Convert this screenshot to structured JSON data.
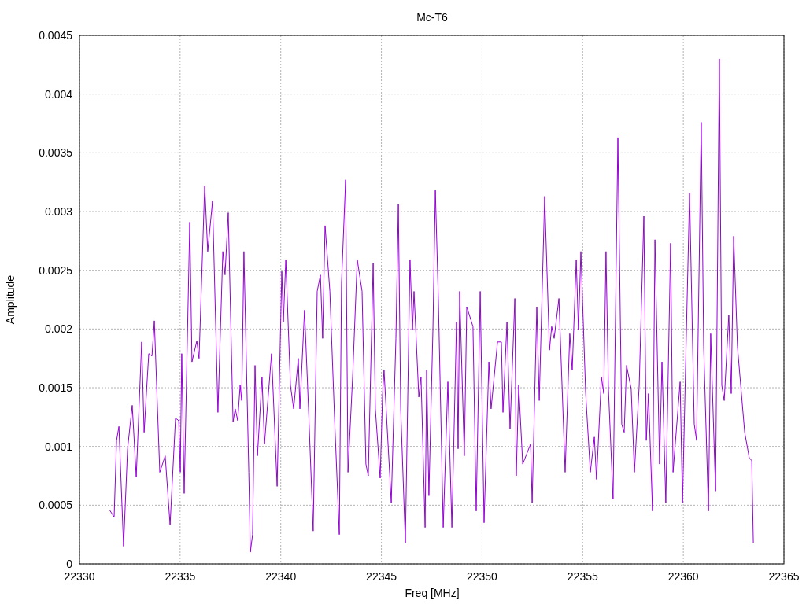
{
  "chart": {
    "chart_data": {
      "type": "line",
      "grid": true,
      "title": "Mc-T6",
      "xlabel": "Freq [MHz]",
      "ylabel": "Amplitude",
      "xlim": [
        22330,
        22365
      ],
      "ylim": [
        0,
        0.0045
      ],
      "xticks": [
        22330,
        22335,
        22340,
        22345,
        22350,
        22355,
        22360,
        22365
      ],
      "yticks": [
        0,
        0.0005,
        0.001,
        0.0015,
        0.002,
        0.0025,
        0.003,
        0.0035,
        0.004,
        0.0045
      ],
      "x": [
        22331.49,
        22331.72,
        22331.84,
        22331.96,
        22332.19,
        22332.39,
        22332.62,
        22332.82,
        22333.09,
        22333.21,
        22333.44,
        22333.6,
        22333.72,
        22333.99,
        22334.26,
        22334.5,
        22334.77,
        22334.93,
        22335.01,
        22335.08,
        22335.2,
        22335.48,
        22335.59,
        22335.83,
        22335.94,
        22336.22,
        22336.37,
        22336.61,
        22336.88,
        22337.12,
        22337.23,
        22337.39,
        22337.63,
        22337.74,
        22337.86,
        22337.98,
        22338.06,
        22338.17,
        22338.41,
        22338.49,
        22338.6,
        22338.72,
        22338.84,
        22339.07,
        22339.19,
        22339.54,
        22339.82,
        22340.05,
        22340.13,
        22340.25,
        22340.48,
        22340.64,
        22340.87,
        22340.95,
        22341.18,
        22341.38,
        22341.61,
        22341.81,
        22341.97,
        22342.08,
        22342.2,
        22342.44,
        22342.67,
        22342.91,
        22343.02,
        22343.22,
        22343.34,
        22343.57,
        22343.8,
        22344.04,
        22344.23,
        22344.35,
        22344.59,
        22344.7,
        22344.94,
        22345.06,
        22345.13,
        22345.49,
        22345.72,
        22345.84,
        22345.96,
        22346.19,
        22346.42,
        22346.54,
        22346.62,
        22346.86,
        22346.97,
        22347.17,
        22347.25,
        22347.36,
        22347.56,
        22347.68,
        22347.83,
        22348.07,
        22348.3,
        22348.5,
        22348.73,
        22348.81,
        22348.89,
        22349.12,
        22349.24,
        22349.55,
        22349.71,
        22349.91,
        22350.1,
        22350.34,
        22350.45,
        22350.77,
        22350.96,
        22351.04,
        22351.24,
        22351.39,
        22351.63,
        22351.7,
        22351.82,
        22352.02,
        22352.41,
        22352.49,
        22352.72,
        22352.84,
        22353.11,
        22353.35,
        22353.46,
        22353.58,
        22353.82,
        22354.13,
        22354.36,
        22354.48,
        22354.68,
        22354.79,
        22354.91,
        22355.15,
        22355.38,
        22355.58,
        22355.69,
        22355.93,
        22356.05,
        22356.16,
        22356.28,
        22356.51,
        22356.75,
        22356.94,
        22357.06,
        22357.18,
        22357.41,
        22357.57,
        22357.81,
        22358.04,
        22358.16,
        22358.27,
        22358.47,
        22358.59,
        22358.82,
        22358.94,
        22359.13,
        22359.37,
        22359.49,
        22359.84,
        22359.96,
        22360.31,
        22360.54,
        22360.66,
        22360.89,
        22361.01,
        22361.25,
        22361.36,
        22361.6,
        22361.79,
        22361.91,
        22362.03,
        22362.26,
        22362.38,
        22362.5,
        22362.69,
        22363.05,
        22363.28,
        22363.4,
        22363.48
      ],
      "series": [
        {
          "color": "#9400d3",
          "values": [
            0.00046,
            0.0004,
            0.00105,
            0.00117,
            0.00015,
            0.00098,
            0.00135,
            0.00074,
            0.00189,
            0.00112,
            0.00179,
            0.00177,
            0.00207,
            0.00078,
            0.00092,
            0.00033,
            0.00124,
            0.00122,
            0.00078,
            0.00179,
            0.0006,
            0.00291,
            0.00172,
            0.0019,
            0.00175,
            0.00322,
            0.00266,
            0.00309,
            0.00129,
            0.00266,
            0.00246,
            0.00299,
            0.00121,
            0.00132,
            0.00122,
            0.00152,
            0.00139,
            0.00266,
            0.00078,
            0.0001,
            0.00025,
            0.00169,
            0.00092,
            0.00159,
            0.00102,
            0.00179,
            0.00066,
            0.00249,
            0.00206,
            0.00259,
            0.00152,
            0.00132,
            0.00175,
            0.00132,
            0.00216,
            0.00132,
            0.00028,
            0.00232,
            0.00246,
            0.00192,
            0.00288,
            0.00232,
            0.00125,
            0.00025,
            0.00239,
            0.00327,
            0.00078,
            0.00159,
            0.00259,
            0.00232,
            0.00085,
            0.00075,
            0.00256,
            0.00132,
            0.00073,
            0.00145,
            0.00165,
            0.00052,
            0.00192,
            0.00306,
            0.00132,
            0.00018,
            0.00259,
            0.00199,
            0.00232,
            0.00142,
            0.00159,
            0.00031,
            0.00165,
            0.00058,
            0.00199,
            0.00318,
            0.00226,
            0.00031,
            0.00155,
            0.00031,
            0.00206,
            0.00098,
            0.00232,
            0.00092,
            0.00219,
            0.00202,
            0.00045,
            0.00232,
            0.00035,
            0.00172,
            0.00132,
            0.00189,
            0.00189,
            0.00129,
            0.00206,
            0.00115,
            0.00226,
            0.00075,
            0.00152,
            0.00085,
            0.00102,
            0.00052,
            0.00219,
            0.00139,
            0.00313,
            0.00182,
            0.00202,
            0.00192,
            0.00226,
            0.00078,
            0.00196,
            0.00165,
            0.00259,
            0.00199,
            0.00266,
            0.00145,
            0.00078,
            0.00108,
            0.00072,
            0.00159,
            0.00145,
            0.00266,
            0.00149,
            0.00055,
            0.00363,
            0.00119,
            0.00112,
            0.00169,
            0.00149,
            0.00078,
            0.00152,
            0.00296,
            0.00105,
            0.00145,
            0.00045,
            0.00276,
            0.00085,
            0.00172,
            0.00052,
            0.00273,
            0.00078,
            0.00155,
            0.00052,
            0.00316,
            0.00119,
            0.00105,
            0.00376,
            0.00185,
            0.00045,
            0.00196,
            0.00062,
            0.0043,
            0.00152,
            0.00139,
            0.00212,
            0.00145,
            0.00279,
            0.00185,
            0.00112,
            0.0009,
            0.00088,
            0.00018
          ]
        }
      ]
    }
  }
}
